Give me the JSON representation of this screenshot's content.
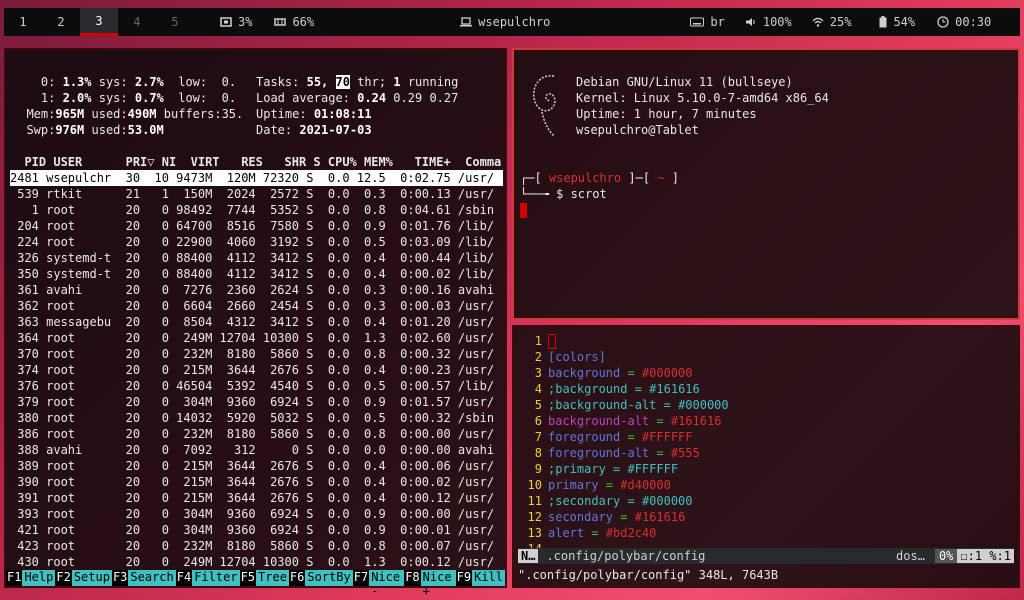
{
  "bar": {
    "workspaces": [
      "1",
      "2",
      "3",
      "4",
      "5"
    ],
    "active": 2,
    "cpu": "3%",
    "mem": "66%",
    "hostname": "wsepulchro",
    "layout": "br",
    "volume": "100%",
    "wifi": "25%",
    "battery": "54%",
    "time": "00:30"
  },
  "htop": {
    "cpu0": [
      "0:",
      "1.3%",
      "sys:",
      "2.7%",
      "low:",
      "0."
    ],
    "cpu1": [
      "1:",
      "2.0%",
      "sys:",
      "0.7%",
      "low:",
      "0."
    ],
    "mem": [
      "Mem:",
      "965M",
      "used:",
      "490M",
      "buffers:",
      "35."
    ],
    "swp": [
      "Swp:",
      "976M",
      "used:",
      "53.0M"
    ],
    "tasks": [
      "Tasks:",
      "55,",
      "70",
      "thr;",
      "1",
      "running"
    ],
    "load": [
      "Load average:",
      "0.24",
      "0.29",
      "0.27"
    ],
    "uptime": [
      "Uptime:",
      "01:08:11"
    ],
    "date": [
      "Date:",
      "2021-07-03"
    ],
    "header": "  PID USER      PRI▽ NI  VIRT   RES   SHR S CPU% MEM%   TIME+  Comma",
    "rows": [
      "2481 wsepulchr  30  10 9473M  120M 72320 S  0.0 12.5  0:02.75 /usr/",
      " 539 rtkit      21   1  150M  2024  2572 S  0.0  0.3  0:00.13 /usr/",
      "   1 root       20   0 98492  7744  5352 S  0.0  0.8  0:04.61 /sbin",
      " 204 root       20   0 64700  8516  7580 S  0.0  0.9  0:01.76 /lib/",
      " 224 root       20   0 22900  4060  3192 S  0.0  0.5  0:03.09 /lib/",
      " 326 systemd-t  20   0 88400  4112  3412 S  0.0  0.4  0:00.44 /lib/",
      " 350 systemd-t  20   0 88400  4112  3412 S  0.0  0.4  0:00.02 /lib/",
      " 361 avahi      20   0  7276  2360  2624 S  0.0  0.3  0:00.16 avahi",
      " 362 root       20   0  6604  2660  2454 S  0.0  0.3  0:00.03 /usr/",
      " 363 messagebu  20   0  8504  4312  3412 S  0.0  0.4  0:01.20 /usr/",
      " 364 root       20   0  249M 12704 10300 S  0.0  1.3  0:02.60 /usr/",
      " 370 root       20   0  232M  8180  5860 S  0.0  0.8  0:00.32 /usr/",
      " 374 root       20   0  215M  3644  2676 S  0.0  0.4  0:00.23 /usr/",
      " 376 root       20   0 46504  5392  4540 S  0.0  0.5  0:00.57 /lib/",
      " 379 root       20   0  304M  9360  6924 S  0.0  0.9  0:01.57 /usr/",
      " 380 root       20   0 14032  5920  5032 S  0.0  0.5  0:00.32 /sbin",
      " 386 root       20   0  232M  8180  5860 S  0.0  0.8  0:00.00 /usr/",
      " 388 avahi      20   0  7092   312     0 S  0.0  0.0  0:00.00 avahi",
      " 389 root       20   0  215M  3644  2676 S  0.0  0.4  0:00.06 /usr/",
      " 390 root       20   0  215M  3644  2676 S  0.0  0.4  0:00.02 /usr/",
      " 391 root       20   0  215M  3644  2676 S  0.0  0.4  0:00.12 /usr/",
      " 393 root       20   0  304M  9360  6924 S  0.0  0.9  0:00.00 /usr/",
      " 421 root       20   0  304M  9360  6924 S  0.0  0.9  0:00.01 /usr/",
      " 423 root       20   0  232M  8180  5860 S  0.0  0.8  0:00.07 /usr/",
      " 430 root       20   0  249M 12704 10300 S  0.0  1.3  0:00.12 /usr/"
    ],
    "fkeys": [
      [
        "F1",
        "Help"
      ],
      [
        "F2",
        "Setup"
      ],
      [
        "F3",
        "Search"
      ],
      [
        "F4",
        "Filter"
      ],
      [
        "F5",
        "Tree"
      ],
      [
        "F6",
        "SortBy"
      ],
      [
        "F7",
        "Nice -"
      ],
      [
        "F8",
        "Nice +"
      ],
      [
        "F9",
        "Kill"
      ]
    ]
  },
  "term": {
    "os": "Debian GNU/Linux 11 (bullseye)",
    "kernel": "Kernel: Linux 5.10.0-7-amd64 x86_64",
    "uptime": "Uptime: 1 hour, 7 minutes",
    "user": "wsepulchro@Tablet",
    "prompt_user": "wsepulchro",
    "prompt_dir": "~",
    "command": "$ scrot"
  },
  "vim": {
    "lines": [
      {
        "n": "1",
        "t": ""
      },
      {
        "n": "2",
        "t": "[colors]"
      },
      {
        "n": "3",
        "k": "background",
        "v": "#000000"
      },
      {
        "n": "4",
        "k": ";background",
        "v": "#161616"
      },
      {
        "n": "5",
        "k": ";background-alt",
        "v": "#000000"
      },
      {
        "n": "6",
        "k": "background-alt",
        "v": "#161616"
      },
      {
        "n": "7",
        "k": "foreground",
        "v": "#FFFFFF"
      },
      {
        "n": "8",
        "k": "foreground-alt",
        "v": "#555"
      },
      {
        "n": "9",
        "k": ";primary",
        "v": "#FFFFFF"
      },
      {
        "n": "10",
        "k": "primary",
        "v": "#d40000"
      },
      {
        "n": "11",
        "k": ";secondary",
        "v": "#000000"
      },
      {
        "n": "12",
        "k": "secondary",
        "v": "#161616"
      },
      {
        "n": "13",
        "k": "alert",
        "v": "#bd2c40"
      },
      {
        "n": "14",
        "t": ""
      }
    ],
    "mode": "N…",
    "file": ".config/polybar/config",
    "ft": "dos…",
    "pct": "0%",
    "pos1": ":1",
    "pos2": "%:1",
    "cmd": "\".config/polybar/config\" 348L, 7643B"
  }
}
